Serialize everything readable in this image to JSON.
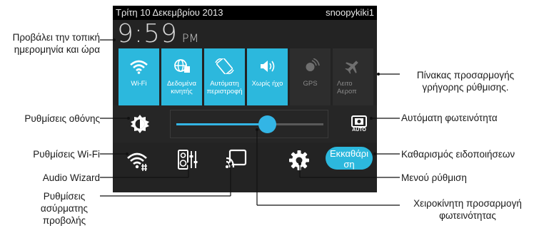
{
  "status_bar": {
    "date": "Τρίτη 10 Δεκεμβρίου 2013",
    "user": "snoopykiki1"
  },
  "clock": {
    "time": "9:59",
    "ampm": "PM"
  },
  "quick_tiles": [
    {
      "label": "Wi-Fi",
      "icon": "wifi-icon",
      "state": "on"
    },
    {
      "label": "Δεδομένα κινητής",
      "icon": "mobile-data-icon",
      "state": "on"
    },
    {
      "label": "Αυτόματη περιστροφή",
      "icon": "rotate-icon",
      "state": "on"
    },
    {
      "label": "Χωρίς ήχο",
      "icon": "speaker-vibrate-icon",
      "state": "on"
    },
    {
      "label": "GPS",
      "icon": "gps-icon",
      "state": "off"
    },
    {
      "label": "Λειτο Αεροπ",
      "icon": "airplane-icon",
      "state": "off"
    }
  ],
  "brightness": {
    "level": 0.62,
    "auto_label": "AUTO"
  },
  "clear_button_label": "Εκκαθάρι ση",
  "callouts": {
    "datetime": "Προβάλει την τοπική ημερομηνία και ώρα",
    "display": "Ρυθμίσεις οθόνης",
    "wifi": "Ρυθμίσεις Wi-Fi",
    "audio": "Audio Wizard",
    "wireless": "Ρυθμίσεις ασύρματης προβολής",
    "quick_panel": "Πίνακας προσαρμογής γρήγορης ρύθμισης.",
    "auto_brightness": "Αυτόματη φωτεινότητα",
    "clear": "Καθαρισμός ειδοποιήσεων",
    "settings": "Μενού ρύθμιση",
    "manual_brightness": "Χειροκίνητη προσαρμογή φωτεινότητας"
  },
  "colors": {
    "accent": "#2cb8dd",
    "panel": "#232323",
    "line": "#111111"
  }
}
